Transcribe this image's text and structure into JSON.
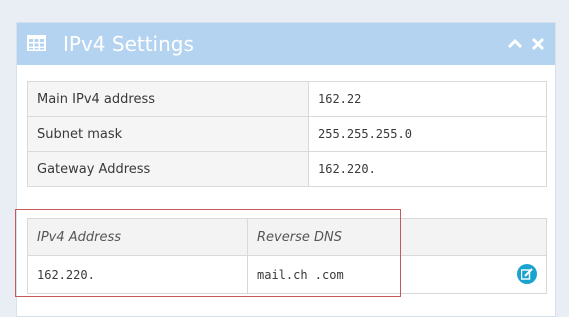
{
  "panel": {
    "title": "IPv4 Settings",
    "icons": {
      "header": "table-grid-icon",
      "collapse": "chevron-up-icon",
      "close": "close-icon",
      "edit": "edit-icon"
    }
  },
  "settings": [
    {
      "key": "Main IPv4 address",
      "value": "162.22"
    },
    {
      "key": "Subnet mask",
      "value": "255.255.255.0"
    },
    {
      "key": "Gateway Address",
      "value": "162.220."
    }
  ],
  "ips_table": {
    "headers": [
      "IPv4 Address",
      "Reverse DNS",
      ""
    ],
    "rows": [
      {
        "ip": "162.220.",
        "rdns": "mail.ch       .com"
      }
    ]
  },
  "colors": {
    "header_bg": "#b4d3f0",
    "edit_button": "#1aa3cf",
    "highlight_border": "#c45a5a"
  }
}
